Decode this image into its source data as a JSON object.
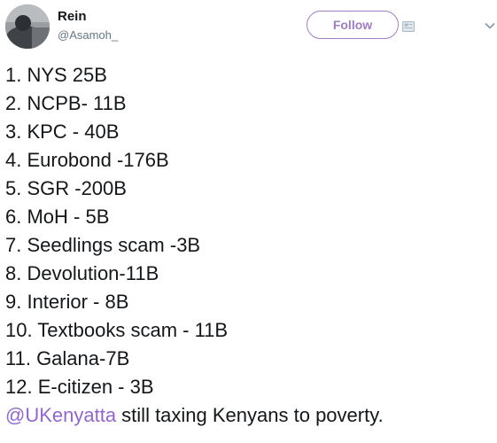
{
  "colors": {
    "accent": "#a07cc5",
    "mention": "#9266cc",
    "text": "#14171a",
    "secondary_text": "#657786"
  },
  "user": {
    "display_name": "Rein",
    "handle": "@Asamoh_",
    "avatar_icon": "profile-photo"
  },
  "actions": {
    "follow_label": "Follow",
    "card_icon": "card-icon",
    "more_icon": "chevron-down-icon"
  },
  "tweet": {
    "lines": [
      "1. NYS 25B",
      "2. NCPB- 11B",
      "3. KPC - 40B",
      "4. Eurobond -176B",
      "5. SGR -200B",
      "6. MoH - 5B",
      "7. Seedlings scam -3B",
      "8. Devolution-11B",
      "9. Interior - 8B",
      "10. Textbooks scam - 11B",
      "11. Galana-7B",
      "12. E-citizen - 3B"
    ],
    "mention": "@UKenyatta",
    "closing_text": " still taxing Kenyans to poverty."
  }
}
